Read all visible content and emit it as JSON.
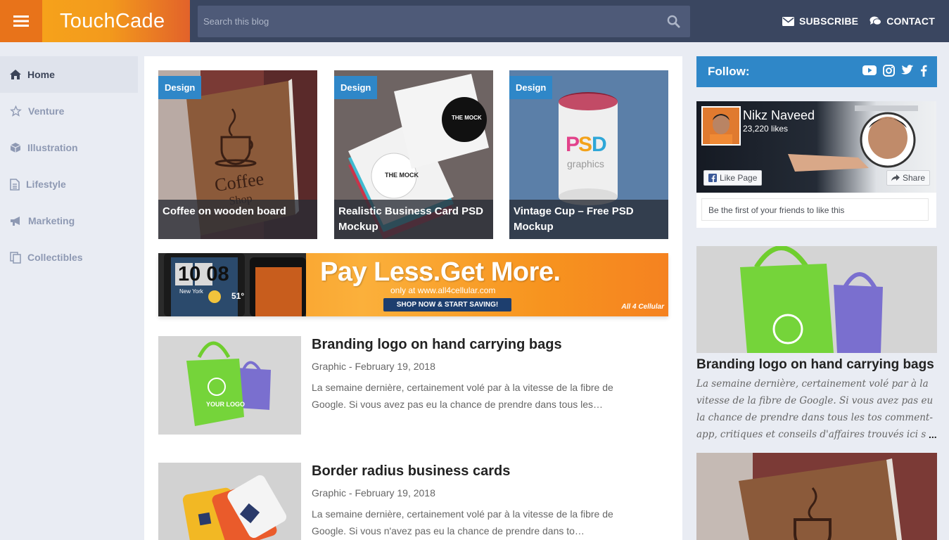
{
  "brand": {
    "logo_text": "TouchCade",
    "accent": "#e8731a",
    "topbar_bg": "#3a4660",
    "blue": "#2f87c8"
  },
  "search": {
    "placeholder": "Search this blog",
    "value": ""
  },
  "topnav": {
    "subscribe": "SUBSCRIBE",
    "contact": "CONTACT"
  },
  "sidebar": {
    "items": [
      {
        "label": "Home",
        "icon": "home-icon",
        "active": true
      },
      {
        "label": "Venture",
        "icon": "star-icon"
      },
      {
        "label": "Illustration",
        "icon": "cube-icon"
      },
      {
        "label": "Lifestyle",
        "icon": "document-icon"
      },
      {
        "label": "Marketing",
        "icon": "megaphone-icon"
      },
      {
        "label": "Collectibles",
        "icon": "copy-icon"
      }
    ]
  },
  "featured": [
    {
      "tag": "Design",
      "title": "Coffee on wooden board"
    },
    {
      "tag": "Design",
      "title": "Realistic Business Card PSD Mockup"
    },
    {
      "tag": "Design",
      "title": "Vintage Cup – Free PSD Mockup"
    }
  ],
  "ad": {
    "headline": "Pay Less.Get More.",
    "subline": "only at www.all4cellular.com",
    "button": "SHOP NOW & START SAVING!",
    "brand": "All 4 Cellular",
    "phone_clock": "10 08",
    "phone_temp": "51°",
    "phone_city": "New York"
  },
  "posts": [
    {
      "title": "Branding logo on hand carrying bags",
      "meta": "Graphic - February 19, 2018",
      "excerpt": "La semaine dernière, certainement volé par à la vitesse de la fibre de Google. Si vous avez pas eu la chance de prendre dans tous les…"
    },
    {
      "title": "Border radius business cards",
      "meta": "Graphic - February 19, 2018",
      "excerpt": "La semaine dernière, certainement volé par à la vitesse de la fibre de Google. Si vous n'avez pas eu la chance de prendre dans to…"
    }
  ],
  "right": {
    "follow_label": "Follow:",
    "social_icons": [
      "youtube-icon",
      "instagram-icon",
      "twitter-icon",
      "facebook-icon"
    ],
    "fb": {
      "name": "Nikz Naveed",
      "likes": "23,220 likes",
      "like_button": "Like Page",
      "share_button": "Share",
      "note": "Be the first of your friends to like this"
    },
    "side_post": {
      "title": "Branding logo on hand carrying bags",
      "excerpt": "La semaine dernière, certainement volé par à la vitesse de la fibre de Google. Si vous avez pas eu la chance de prendre dans tous les tos comment-app, critiques et conseils d'affaires trouvés ici s",
      "more": "..."
    }
  }
}
